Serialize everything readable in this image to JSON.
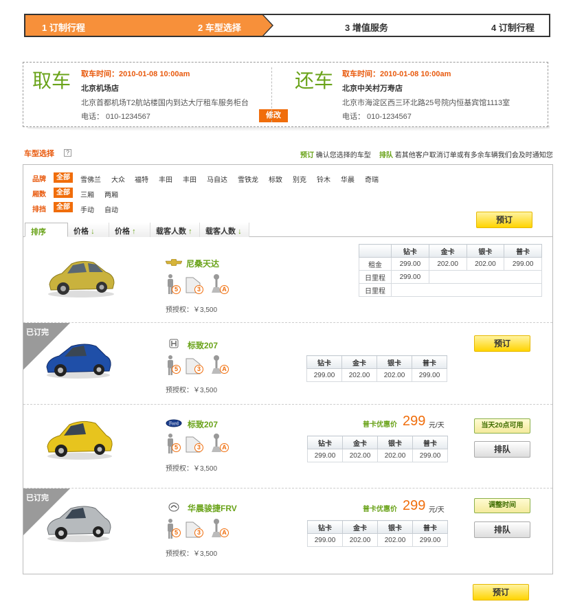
{
  "steps": [
    {
      "label": "1 订制行程"
    },
    {
      "label": "2 车型选择"
    },
    {
      "label": "3 增值服务"
    },
    {
      "label": "4 订制行程"
    }
  ],
  "pickup": {
    "title": "取车",
    "time_label": "取车时间：",
    "time": "2010-01-08  10:00am",
    "store": "北京机场店",
    "address": "北京首都机场T2航站楼国内到达大厅租车服务柜台",
    "phone": "电话：  010-1234567",
    "modify_label": "修改"
  },
  "return": {
    "title": "还车",
    "time_label": "取车时间：",
    "time": "2010-01-08  10:00am",
    "store": "北京中关村万寿店",
    "address": "北京市海淀区西三环北路25号院内恒基宾馆1113室",
    "phone": "电话：  010-1234567"
  },
  "section": {
    "title": "车型选择",
    "help": "?",
    "legend1_key": "预订",
    "legend1_text": "确认您选择的车型",
    "legend2_key": "排队",
    "legend2_text": "若其他客户取消订单或有多余车辆我们会及时通知您"
  },
  "filters": {
    "brand_label": "品牌",
    "brands": [
      "全部",
      "雪佛兰",
      "大众",
      "福特",
      "丰田",
      "丰田",
      "马自达",
      "雪铁龙",
      "标致",
      "别克",
      "铃木",
      "华晨",
      "奇瑞"
    ],
    "body_label": "厢数",
    "bodies": [
      "全部",
      "三厢",
      "两厢"
    ],
    "gear_label": "排挡",
    "gears": [
      "全部",
      "手动",
      "自动"
    ]
  },
  "sort_tabs": [
    {
      "label": "排序",
      "arrow": ""
    },
    {
      "label": "价格",
      "arrow": "↓"
    },
    {
      "label": "价格",
      "arrow": "↑"
    },
    {
      "label": "载客人数",
      "arrow": "↑"
    },
    {
      "label": "载客人数",
      "arrow": "↓"
    }
  ],
  "top_book_label": "预订",
  "bottom_book_label": "预订",
  "price_headers": [
    "钻卡",
    "金卡",
    "银卡",
    "普卡"
  ],
  "cars": [
    {
      "name": "尼桑天达",
      "seats": "5",
      "doors": "3",
      "gear": "A",
      "deposit": "预授权：￥3,500",
      "rows": [
        {
          "label": "租金",
          "values": [
            "299.00",
            "202.00",
            "202.00",
            "299.00"
          ]
        },
        {
          "label": "日里程",
          "values": [
            "299.00"
          ]
        },
        {
          "label": "日里程",
          "values": []
        }
      ]
    },
    {
      "name": "标致207",
      "badge": "已订完",
      "seats": "5",
      "doors": "3",
      "gear": "A",
      "deposit": "预授权：￥3,500",
      "values": [
        "299.00",
        "202.00",
        "202.00",
        "299.00"
      ],
      "button": "预订"
    },
    {
      "name": "标致207",
      "seats": "5",
      "doors": "3",
      "gear": "A",
      "deposit": "预授权：￥3,500",
      "promo_label": "普卡优惠价",
      "promo_price": "299",
      "promo_unit": "元/天",
      "values": [
        "299.00",
        "202.00",
        "202.00",
        "299.00"
      ],
      "button1": "当天20点可用",
      "button2": "排队"
    },
    {
      "name": "华晨骏捷FRV",
      "badge": "已订完",
      "seats": "5",
      "doors": "3",
      "gear": "A",
      "deposit": "预授权：￥3,500",
      "promo_label": "普卡优惠价",
      "promo_price": "299",
      "promo_unit": "元/天",
      "values": [
        "299.00",
        "202.00",
        "202.00",
        "299.00"
      ],
      "button1": "调整时间",
      "button2": "排队"
    }
  ],
  "colors": {
    "accent": "#f7903a",
    "green": "#6aa31a",
    "orange": "#f06d0b"
  }
}
